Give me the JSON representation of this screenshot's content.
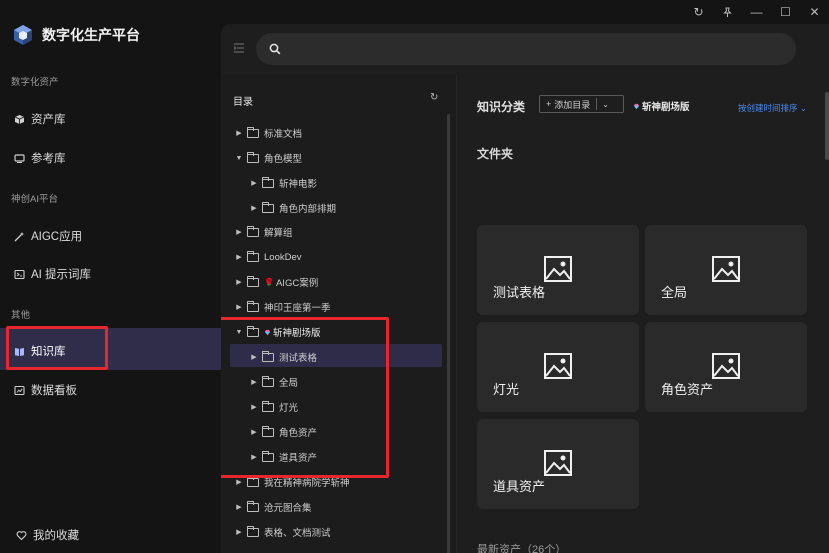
{
  "app": {
    "title": "数字化生产平台"
  },
  "window_controls": [
    "refresh-icon",
    "pin-icon",
    "minimize-icon",
    "maximize-icon",
    "close-icon"
  ],
  "sidebar": {
    "sections": [
      {
        "title": "数字化资产",
        "items": [
          {
            "label": "资产库",
            "icon": "cube-icon"
          },
          {
            "label": "参考库",
            "icon": "monitor-icon"
          }
        ]
      },
      {
        "title": "神创AI平台",
        "items": [
          {
            "label": "AIGC应用",
            "icon": "magic-wand-icon"
          },
          {
            "label": "AI 提示词库",
            "icon": "prompt-icon"
          }
        ]
      },
      {
        "title": "其他",
        "items": [
          {
            "label": "知识库",
            "icon": "book-icon",
            "active": true
          },
          {
            "label": "数据看板",
            "icon": "chart-icon"
          }
        ]
      }
    ],
    "footer": {
      "label": "我的收藏",
      "icon": "heart-icon"
    }
  },
  "search": {
    "placeholder": "",
    "value": ""
  },
  "tree": {
    "title": "目录",
    "nodes": [
      {
        "label": "标准文档",
        "expanded": false,
        "depth": 0
      },
      {
        "label": "角色模型",
        "expanded": true,
        "depth": 0
      },
      {
        "label": "斩神电影",
        "expanded": false,
        "depth": 1
      },
      {
        "label": "角色内部排期",
        "expanded": false,
        "depth": 1
      },
      {
        "label": "解算组",
        "expanded": false,
        "depth": 0
      },
      {
        "label": "LookDev",
        "expanded": false,
        "depth": 0
      },
      {
        "label": "AIGC案例",
        "expanded": false,
        "depth": 0,
        "emoji": "🌹"
      },
      {
        "label": "神印王座第一季",
        "expanded": false,
        "depth": 0
      },
      {
        "label": "斩神剧场版",
        "expanded": true,
        "depth": 0,
        "emoji": "💎",
        "selected": true
      },
      {
        "label": "测试表格",
        "expanded": false,
        "depth": 1
      },
      {
        "label": "全局",
        "expanded": false,
        "depth": 1
      },
      {
        "label": "灯光",
        "expanded": false,
        "depth": 1
      },
      {
        "label": "角色资产",
        "expanded": false,
        "depth": 1
      },
      {
        "label": "道具资产",
        "expanded": false,
        "depth": 1
      },
      {
        "label": "我在精神病院学斩神",
        "expanded": false,
        "depth": 0
      },
      {
        "label": "沧元图合集",
        "expanded": false,
        "depth": 0
      },
      {
        "label": "表格、文档测试",
        "expanded": false,
        "depth": 0
      }
    ]
  },
  "content": {
    "title": "知识分类",
    "add_button": "添加目录",
    "scope": "斩神剧场版",
    "sort": "按创建时间排序",
    "folder_title": "文件夹",
    "cards": [
      "测试表格",
      "全局",
      "灯光",
      "角色资产",
      "道具资产"
    ],
    "recent_title": "最新资产（26个）"
  },
  "colors": {
    "accent_red": "#e8262e",
    "active_bg": "#2f2d4a",
    "link_blue": "#4a8bf0"
  }
}
